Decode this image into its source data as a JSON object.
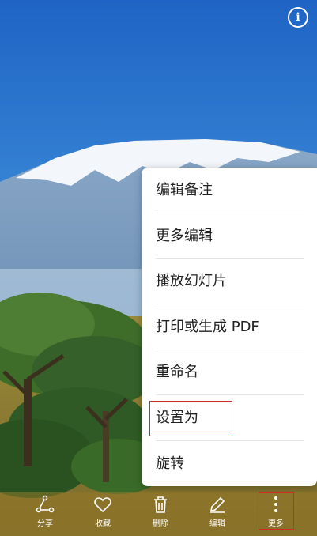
{
  "menu": {
    "items": [
      {
        "label": "编辑备注"
      },
      {
        "label": "更多编辑"
      },
      {
        "label": "播放幻灯片"
      },
      {
        "label": "打印或生成 PDF"
      },
      {
        "label": "重命名"
      },
      {
        "label": "设置为"
      },
      {
        "label": "旋转"
      }
    ],
    "highlighted_item": "设置为"
  },
  "toolbar": {
    "share": {
      "label": "分享",
      "icon": "share-icon"
    },
    "favorite": {
      "label": "收藏",
      "icon": "heart-icon"
    },
    "delete": {
      "label": "删除",
      "icon": "trash-icon"
    },
    "edit": {
      "label": "编辑",
      "icon": "pencil-icon"
    },
    "more": {
      "label": "更多",
      "icon": "more-vertical-icon"
    }
  },
  "info_icon": "info-icon",
  "colors": {
    "highlight": "#d12a2a"
  }
}
